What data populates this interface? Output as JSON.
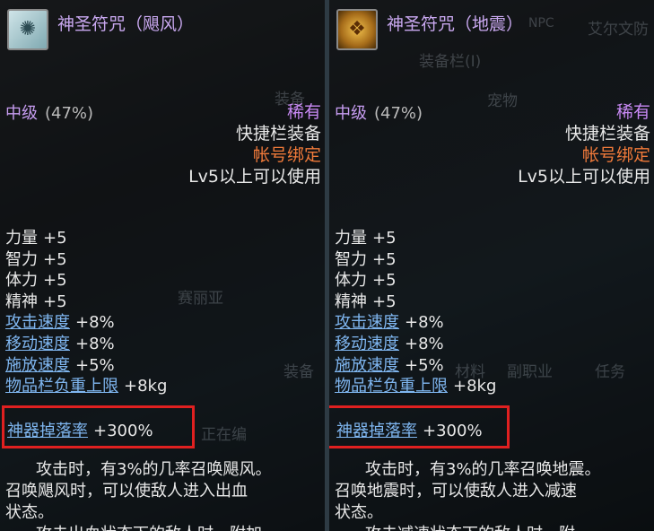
{
  "left": {
    "title": "神圣符咒（飓风）",
    "icon": "wind-talisman-icon",
    "grade": "中级",
    "grade_pct": "(47%)",
    "rarity": "稀有",
    "quickbar": "快捷栏装备",
    "bound": "帐号绑定",
    "level": "Lv5以上可以使用",
    "stats": [
      {
        "label": "力量",
        "value": "+5"
      },
      {
        "label": "智力",
        "value": "+5"
      },
      {
        "label": "体力",
        "value": "+5"
      },
      {
        "label": "精神",
        "value": "+5"
      },
      {
        "label": "攻击速度",
        "value": "+8%"
      },
      {
        "label": "移动速度",
        "value": "+8%"
      },
      {
        "label": "施放速度",
        "value": "+5%"
      },
      {
        "label": "物品栏负重上限",
        "value": "+8kg"
      }
    ],
    "drop_label": "神器掉落率",
    "drop_value": "+300%",
    "desc_line1": "攻击时，有3%的几率召唤飓风。",
    "desc_line2": "召唤飓风时，可以使敌人进入出血",
    "desc_line3": "状态。",
    "desc_line4": "攻击出血状态下的敌人时，附加"
  },
  "right": {
    "title": "神圣符咒（地震）",
    "icon": "earthquake-talisman-icon",
    "grade": "中级",
    "grade_pct": "(47%)",
    "rarity": "稀有",
    "quickbar": "快捷栏装备",
    "bound": "帐号绑定",
    "level": "Lv5以上可以使用",
    "stats": [
      {
        "label": "力量",
        "value": "+5"
      },
      {
        "label": "智力",
        "value": "+5"
      },
      {
        "label": "体力",
        "value": "+5"
      },
      {
        "label": "精神",
        "value": "+5"
      },
      {
        "label": "攻击速度",
        "value": "+8%"
      },
      {
        "label": "移动速度",
        "value": "+8%"
      },
      {
        "label": "施放速度",
        "value": "+5%"
      },
      {
        "label": "物品栏负重上限",
        "value": "+8kg"
      }
    ],
    "drop_label": "神器掉落率",
    "drop_value": "+300%",
    "desc_line1": "攻击时，有3%的几率召唤地震。",
    "desc_line2": "召唤地震时，可以使敌人进入减速",
    "desc_line3": "状态。",
    "desc_line4": "攻击减速状态下的敌人时，附"
  },
  "background": {
    "equip_window": "装备栏(I)",
    "npc_tab": "NPC",
    "town": "艾尔文防",
    "tab_pet": "宠物",
    "tab_skill": "副职业",
    "tab_task": "任务",
    "tab_equip": "装备",
    "tab_material": "材料",
    "character": "赛丽亚",
    "equipping": "正在编"
  },
  "colors": {
    "highlight": "#e02020",
    "blue_stat": "#7fb6f0",
    "rarity": "#c98af5",
    "bound": "#f07a3a"
  }
}
